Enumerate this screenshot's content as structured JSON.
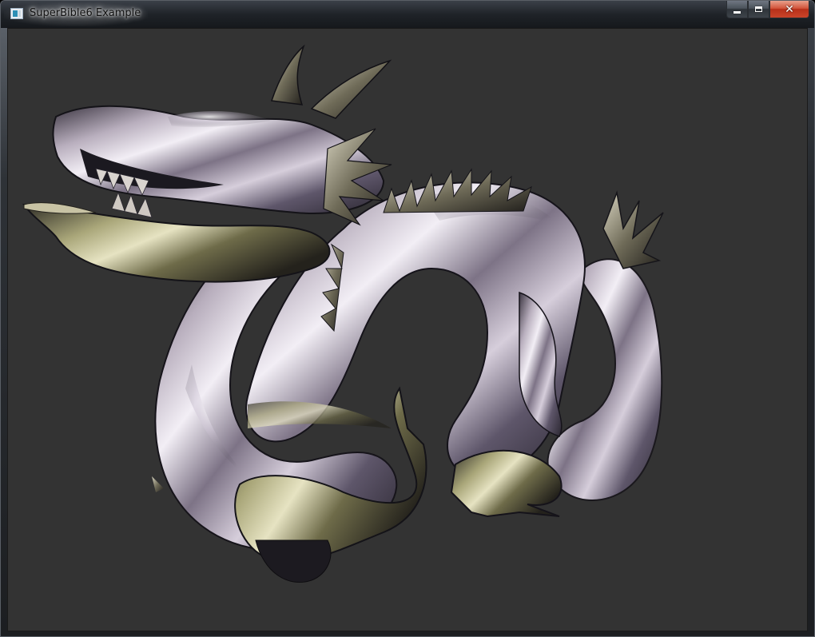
{
  "window": {
    "title": "SuperBible6 Example",
    "icon": "application-window-icon"
  },
  "caption_buttons": {
    "minimize_icon": "minimize-icon",
    "maximize_icon": "maximize-icon",
    "close_icon": "close-icon",
    "close_glyph": "✕"
  },
  "viewport": {
    "background_color": "#333333",
    "content": "rendered-3d-dragon-model"
  },
  "colors": {
    "metal_light": "#e8e4ec",
    "metal_mid": "#9a8f9e",
    "metal_dark": "#2a2630",
    "metal_olive": "#8c8a5c",
    "close_red": "#c94429"
  }
}
